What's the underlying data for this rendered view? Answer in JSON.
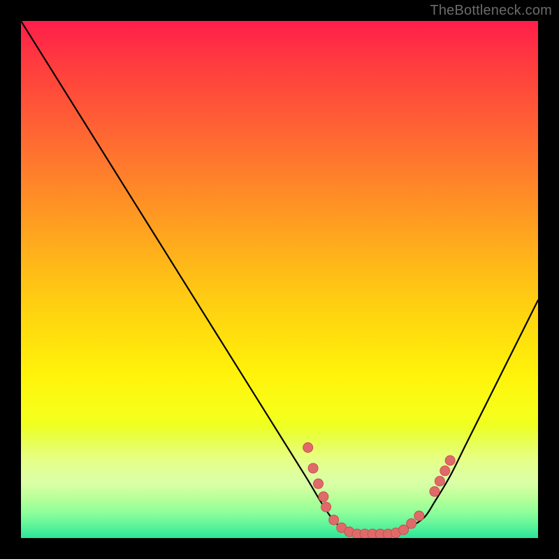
{
  "watermark": "TheBottleneck.com",
  "colors": {
    "background": "#000000",
    "curve": "#000000",
    "dot_fill": "#e06a6a",
    "dot_stroke": "#c94f4f"
  },
  "chart_data": {
    "type": "line",
    "title": "",
    "xlabel": "",
    "ylabel": "",
    "xlim": [
      0,
      100
    ],
    "ylim": [
      0,
      100
    ],
    "grid": false,
    "legend": false,
    "series": [
      {
        "name": "bottleneck-curve",
        "x": [
          0,
          5,
          10,
          15,
          20,
          25,
          30,
          35,
          40,
          45,
          50,
          55,
          58,
          60,
          62,
          65,
          68,
          70,
          72,
          75,
          78,
          80,
          83,
          86,
          90,
          94,
          98,
          100
        ],
        "values": [
          100,
          92,
          84,
          76,
          68,
          60,
          52,
          44,
          36,
          28,
          20,
          12,
          7,
          4,
          2,
          1,
          1,
          1,
          1,
          2,
          4,
          7,
          12,
          18,
          26,
          34,
          42,
          46
        ]
      }
    ],
    "dots": [
      {
        "x": 55.5,
        "y": 17.5
      },
      {
        "x": 56.5,
        "y": 13.5
      },
      {
        "x": 57.5,
        "y": 10.5
      },
      {
        "x": 58.5,
        "y": 8.0
      },
      {
        "x": 59.0,
        "y": 6.0
      },
      {
        "x": 60.5,
        "y": 3.5
      },
      {
        "x": 62.0,
        "y": 2.0
      },
      {
        "x": 63.5,
        "y": 1.2
      },
      {
        "x": 65.0,
        "y": 0.8
      },
      {
        "x": 66.5,
        "y": 0.8
      },
      {
        "x": 68.0,
        "y": 0.8
      },
      {
        "x": 69.5,
        "y": 0.8
      },
      {
        "x": 71.0,
        "y": 0.8
      },
      {
        "x": 72.5,
        "y": 1.0
      },
      {
        "x": 74.0,
        "y": 1.6
      },
      {
        "x": 75.5,
        "y": 2.8
      },
      {
        "x": 77.0,
        "y": 4.3
      },
      {
        "x": 80.0,
        "y": 9.0
      },
      {
        "x": 81.0,
        "y": 11.0
      },
      {
        "x": 82.0,
        "y": 13.0
      },
      {
        "x": 83.0,
        "y": 15.0
      }
    ]
  }
}
